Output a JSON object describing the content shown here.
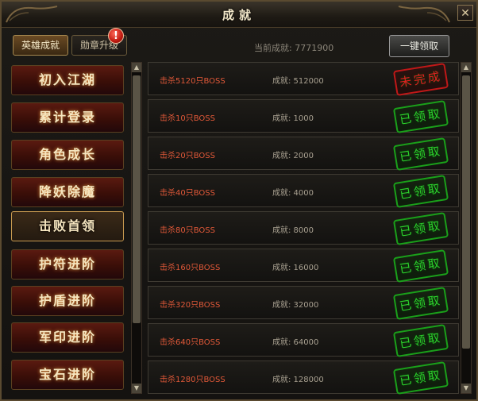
{
  "window": {
    "title": "成就",
    "close_symbol": "✕"
  },
  "tabs": [
    {
      "label": "英雄成就",
      "active": true
    },
    {
      "label": "勋章升级",
      "active": false,
      "badge": "!"
    }
  ],
  "header": {
    "current_score": "当前成就: 7771900",
    "claim_all_label": "一键领取"
  },
  "categories": [
    {
      "label": "初入江湖"
    },
    {
      "label": "累计登录"
    },
    {
      "label": "角色成长"
    },
    {
      "label": "降妖除魔"
    },
    {
      "label": "击败首领",
      "selected": true
    },
    {
      "label": "护符进阶"
    },
    {
      "label": "护盾进阶"
    },
    {
      "label": "军印进阶"
    },
    {
      "label": "宝石进阶"
    }
  ],
  "achievements": [
    {
      "task": "击杀5120只BOSS",
      "score": "成就: 512000",
      "status": "未完成",
      "complete": false
    },
    {
      "task": "击杀10只BOSS",
      "score": "成就: 1000",
      "status": "已领取",
      "complete": true
    },
    {
      "task": "击杀20只BOSS",
      "score": "成就: 2000",
      "status": "已领取",
      "complete": true
    },
    {
      "task": "击杀40只BOSS",
      "score": "成就: 4000",
      "status": "已领取",
      "complete": true
    },
    {
      "task": "击杀80只BOSS",
      "score": "成就: 8000",
      "status": "已领取",
      "complete": true
    },
    {
      "task": "击杀160只BOSS",
      "score": "成就: 16000",
      "status": "已领取",
      "complete": true
    },
    {
      "task": "击杀320只BOSS",
      "score": "成就: 32000",
      "status": "已领取",
      "complete": true
    },
    {
      "task": "击杀640只BOSS",
      "score": "成就: 64000",
      "status": "已领取",
      "complete": true
    },
    {
      "task": "击杀1280只BOSS",
      "score": "成就: 128000",
      "status": "已领取",
      "complete": true
    }
  ],
  "scrollbar": {
    "up_symbol": "▲",
    "down_symbol": "▼"
  },
  "colors": {
    "task_text": "#e05838",
    "stamp_complete": "#2cd02c",
    "stamp_incomplete": "#e22020"
  }
}
